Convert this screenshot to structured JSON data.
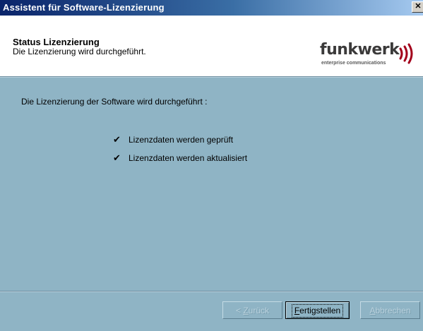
{
  "window": {
    "title": "Assistent für Software-Lizenzierung",
    "close_glyph": "✕"
  },
  "header": {
    "title": "Status Lizenzierung",
    "subtitle": "Die Lizenzierung wird durchgeführt.",
    "logo_text": "funkwerk",
    "logo_tagline": "enterprise communications"
  },
  "main": {
    "intro": "Die Lizenzierung der Software wird durchgeführt :",
    "steps": [
      {
        "label": "Lizenzdaten werden geprüft",
        "icon": "check-icon",
        "status": "done"
      },
      {
        "label": "Lizenzdaten werden aktualisiert",
        "icon": "check-icon",
        "status": "done"
      }
    ]
  },
  "buttons": {
    "back": {
      "prefix": "< ",
      "mnemonic": "Z",
      "rest": "urück",
      "enabled": false
    },
    "finish": {
      "mnemonic": "F",
      "rest": "ertigstellen",
      "enabled": true
    },
    "cancel": {
      "mnemonic": "A",
      "rest": "bbrechen",
      "enabled": false
    }
  },
  "colors": {
    "title_bar_start": "#0a246a",
    "title_bar_end": "#a6caf0",
    "body_bg": "#8fb4c5",
    "header_bg": "#ffffff",
    "logo_accent": "#a3001b"
  }
}
